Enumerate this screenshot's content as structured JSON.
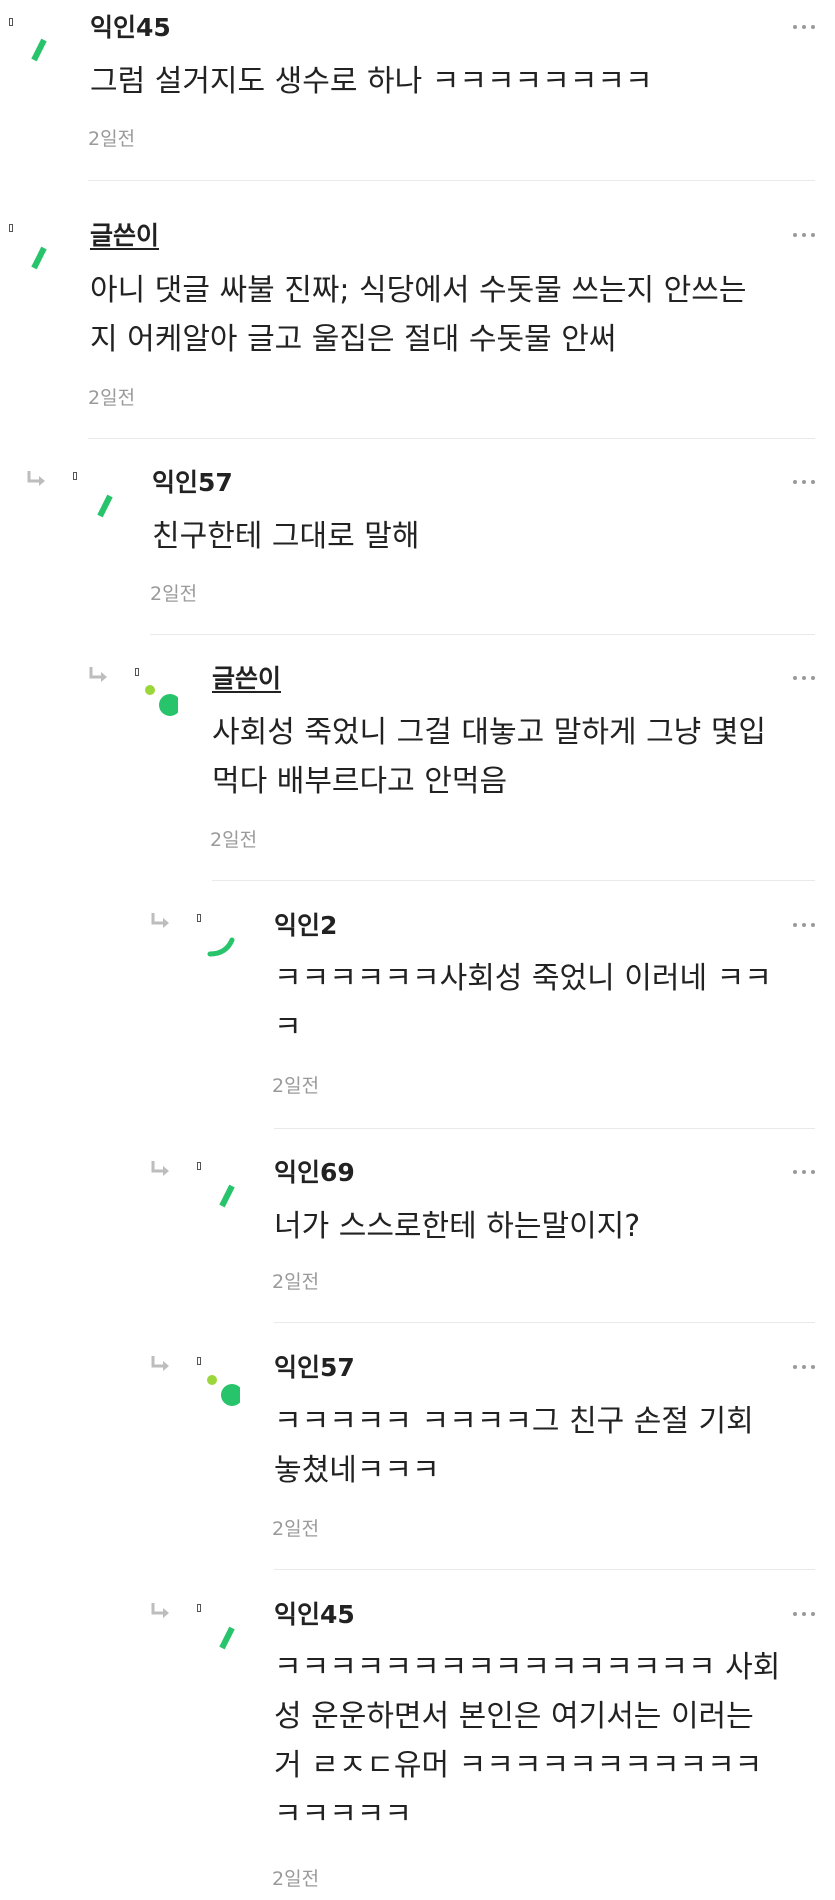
{
  "comments": [
    {
      "author": "익인45",
      "lines": [
        "그럼 설거지도 생수로 하나 ㅋㅋㅋㅋㅋㅋㅋㅋ"
      ],
      "time": "2일전",
      "avatar_icon": "green-dash-icon",
      "is_writer": false,
      "is_reply": false
    },
    {
      "author": "글쓴이",
      "lines": [
        "아니 댓글 싸불 진짜; 식당에서 수돗물 쓰는지 안쓰는",
        "지 어케알아 글고 울집은 절대 수돗물 안써"
      ],
      "time": "2일전",
      "avatar_icon": "green-dash-icon",
      "is_writer": true,
      "is_reply": false
    },
    {
      "author": "익인57",
      "lines": [
        "친구한테 그대로 말해"
      ],
      "time": "2일전",
      "avatar_icon": "green-dash-icon",
      "is_writer": false,
      "is_reply": true
    },
    {
      "author": "글쓴이",
      "lines": [
        "사회성 죽었니 그걸 대놓고 말하게 그냥 몇입",
        "먹다 배부르다고 안먹음"
      ],
      "time": "2일전",
      "avatar_icon": "green-dots-icon",
      "is_writer": true,
      "is_reply": true
    },
    {
      "author": "익인2",
      "lines": [
        "ㅋㅋㅋㅋㅋㅋ사회성 죽었니 이러네 ㅋㅋ",
        "ㅋ"
      ],
      "time": "2일전",
      "avatar_icon": "green-arc-icon",
      "is_writer": false,
      "is_reply": true
    },
    {
      "author": "익인69",
      "lines": [
        "너가 스스로한테 하는말이지?"
      ],
      "time": "2일전",
      "avatar_icon": "green-dash-icon",
      "is_writer": false,
      "is_reply": true
    },
    {
      "author": "익인57",
      "lines": [
        "ㅋㅋㅋㅋㅋ ㅋㅋㅋㅋ그 친구 손절 기회",
        "놓쳤네ㅋㅋㅋ"
      ],
      "time": "2일전",
      "avatar_icon": "green-dots-icon",
      "is_writer": false,
      "is_reply": true
    },
    {
      "author": "익인45",
      "lines": [
        "ㅋㅋㅋㅋㅋㅋㅋㅋㅋㅋㅋㅋㅋㅋㅋㅋ 사회",
        "성 운운하면서 본인은 여기서는 이러는",
        "거 ㄹㅈㄷ유머 ㅋㅋㅋㅋㅋㅋㅋㅋㅋㅋㅋ",
        "ㅋㅋㅋㅋㅋ"
      ],
      "time": "2일전",
      "avatar_icon": "green-dash-icon",
      "is_writer": false,
      "is_reply": true
    }
  ],
  "colors": {
    "accent_green": "#27c46b",
    "accent_lime": "#9bd63b",
    "text": "#222222",
    "muted": "#9a9a9a",
    "divider": "#e9e9e9"
  }
}
